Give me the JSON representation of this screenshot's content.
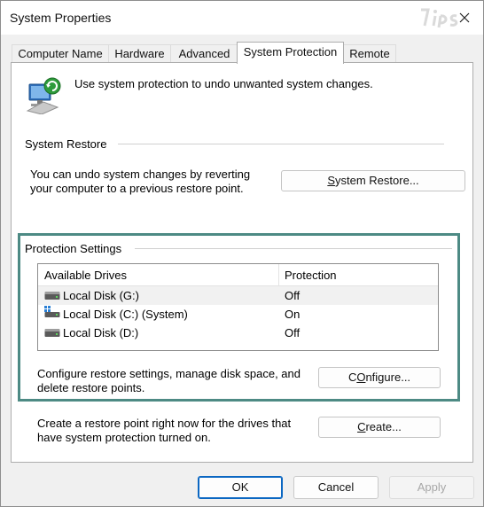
{
  "window": {
    "title": "System Properties"
  },
  "tabs": [
    {
      "label": "Computer Name"
    },
    {
      "label": "Hardware"
    },
    {
      "label": "Advanced"
    },
    {
      "label": "System Protection"
    },
    {
      "label": "Remote"
    }
  ],
  "active_tab": "System Protection",
  "intro": {
    "text": "Use system protection to undo unwanted system changes."
  },
  "system_restore": {
    "group_title": "System Restore",
    "description_line1": "You can undo system changes by reverting",
    "description_line2": "your computer to a previous restore point.",
    "button_label_underlined": "S",
    "button_label_rest": "ystem Restore..."
  },
  "protection_settings": {
    "group_title": "Protection Settings",
    "columns": [
      "Available Drives",
      "Protection"
    ],
    "drives": [
      {
        "name": "Local Disk (G:)",
        "protection": "Off",
        "icon": "drive-icon",
        "selected": true
      },
      {
        "name": "Local Disk (C:) (System)",
        "protection": "On",
        "icon": "system-drive-icon",
        "selected": false
      },
      {
        "name": "Local Disk (D:)",
        "protection": "Off",
        "icon": "drive-icon",
        "selected": false
      }
    ],
    "configure_text_line1": "Configure restore settings, manage disk space, and",
    "configure_text_line2": "delete restore points.",
    "configure_button_underlined": "O",
    "configure_button_prefix": "C",
    "configure_button_rest": "nfigure..."
  },
  "create": {
    "text_line1": "Create a restore point right now for the drives that",
    "text_line2": "have system protection turned on.",
    "button_label_prefix": "",
    "button_label_underlined": "C",
    "button_label_rest": "reate..."
  },
  "footer": {
    "ok_label": "OK",
    "cancel_label": "Cancel",
    "apply_label_underlined": "A",
    "apply_label_rest": "pply"
  },
  "colors": {
    "highlight_border": "#4d8a84",
    "default_button_border": "#0b67c2"
  }
}
